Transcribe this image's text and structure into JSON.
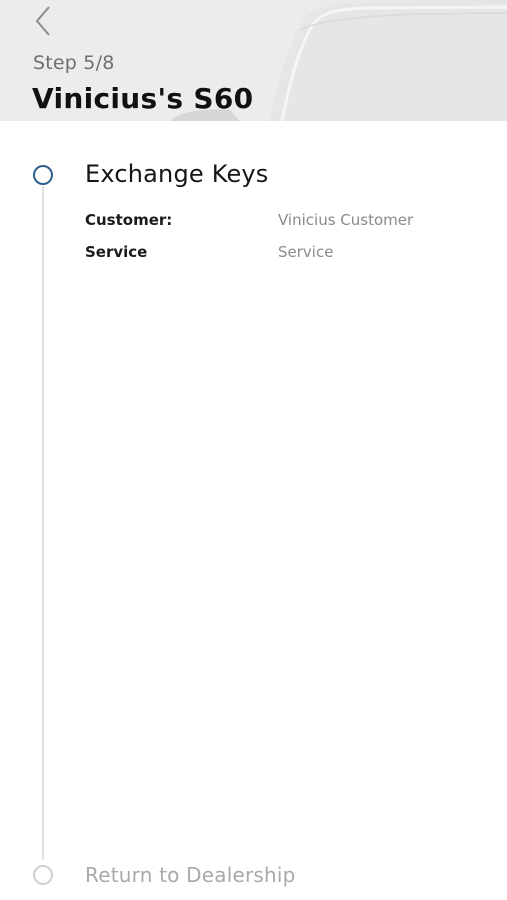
{
  "header": {
    "back_icon": "chevron-left-icon",
    "step_label": "Step 5/8",
    "title": "Vinicius's S60",
    "background_image": "car-silhouette"
  },
  "steps": [
    {
      "title": "Exchange Keys",
      "state": "active",
      "details": [
        {
          "label": "Customer:",
          "value": "Vinicius Customer"
        },
        {
          "label": "Service",
          "value": "Service"
        }
      ]
    },
    {
      "title": "Return to Dealership",
      "state": "pending"
    }
  ],
  "colors": {
    "active_step": "#2d5f8d",
    "pending_step": "#d0d0d0",
    "timeline": "#e2e2e2"
  }
}
